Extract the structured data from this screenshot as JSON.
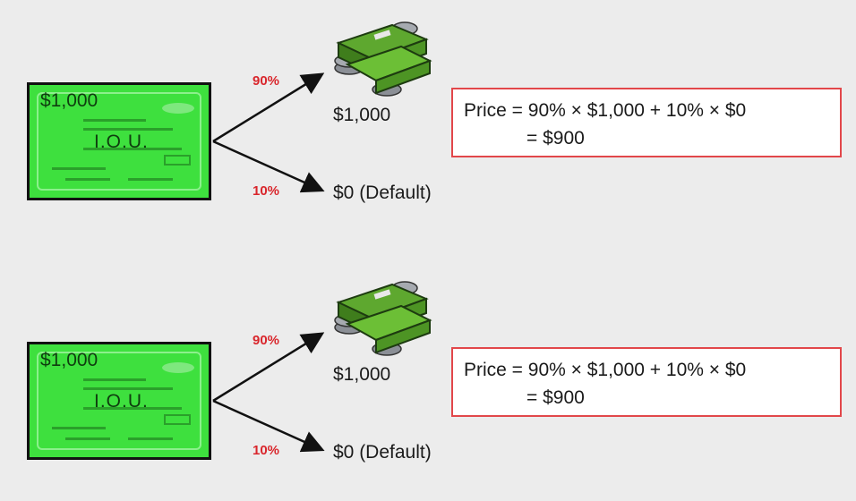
{
  "diagram": {
    "rows": [
      {
        "note": {
          "amount": "$1,000",
          "label": "I.O.U."
        },
        "branch_up": {
          "probability": "90%",
          "outcome": "$1,000"
        },
        "branch_down": {
          "probability": "10%",
          "outcome": "$0 (Default)"
        },
        "formula": {
          "line1": "Price = 90% × $1,000 + 10% × $0",
          "line2": "= $900"
        }
      },
      {
        "note": {
          "amount": "$1,000",
          "label": "I.O.U."
        },
        "branch_up": {
          "probability": "90%",
          "outcome": "$1,000"
        },
        "branch_down": {
          "probability": "10%",
          "outcome": "$0 (Default)"
        },
        "formula": {
          "line1": "Price = 90% × $1,000 + 10% × $0",
          "line2": "= $900"
        }
      }
    ],
    "icons": {
      "money": "money-stack-icon"
    },
    "colors": {
      "note_fill": "#3ee03e",
      "probability_text": "#d9262c",
      "formula_border": "#e2474a",
      "background": "#ececec"
    }
  }
}
